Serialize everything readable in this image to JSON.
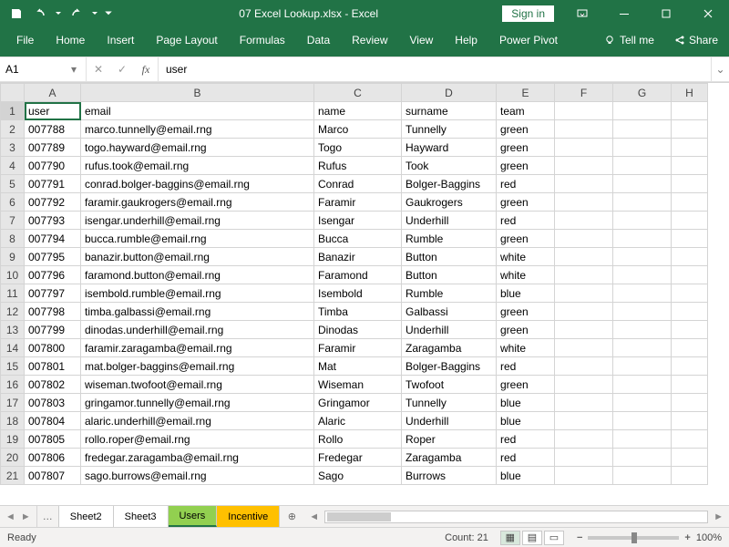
{
  "title": "07 Excel Lookup.xlsx - Excel",
  "signin": "Sign in",
  "ribbon": [
    "File",
    "Home",
    "Insert",
    "Page Layout",
    "Formulas",
    "Data",
    "Review",
    "View",
    "Help",
    "Power Pivot"
  ],
  "tellme": "Tell me",
  "share": "Share",
  "namebox": "A1",
  "formula": "user",
  "columns": [
    "A",
    "B",
    "C",
    "D",
    "E",
    "F",
    "G",
    "H"
  ],
  "headerRow": [
    "user",
    "email",
    "name",
    "surname",
    "team",
    "",
    "",
    ""
  ],
  "rows": [
    [
      "007788",
      "marco.tunnelly@email.rng",
      "Marco",
      "Tunnelly",
      "green",
      "",
      "",
      ""
    ],
    [
      "007789",
      "togo.hayward@email.rng",
      "Togo",
      "Hayward",
      "green",
      "",
      "",
      ""
    ],
    [
      "007790",
      "rufus.took@email.rng",
      "Rufus",
      "Took",
      "green",
      "",
      "",
      ""
    ],
    [
      "007791",
      "conrad.bolger-baggins@email.rng",
      "Conrad",
      "Bolger-Baggins",
      "red",
      "",
      "",
      ""
    ],
    [
      "007792",
      "faramir.gaukrogers@email.rng",
      "Faramir",
      "Gaukrogers",
      "green",
      "",
      "",
      ""
    ],
    [
      "007793",
      "isengar.underhill@email.rng",
      "Isengar",
      "Underhill",
      "red",
      "",
      "",
      ""
    ],
    [
      "007794",
      "bucca.rumble@email.rng",
      "Bucca",
      "Rumble",
      "green",
      "",
      "",
      ""
    ],
    [
      "007795",
      "banazir.button@email.rng",
      "Banazir",
      "Button",
      "white",
      "",
      "",
      ""
    ],
    [
      "007796",
      "faramond.button@email.rng",
      "Faramond",
      "Button",
      "white",
      "",
      "",
      ""
    ],
    [
      "007797",
      "isembold.rumble@email.rng",
      "Isembold",
      "Rumble",
      "blue",
      "",
      "",
      ""
    ],
    [
      "007798",
      "timba.galbassi@email.rng",
      "Timba",
      "Galbassi",
      "green",
      "",
      "",
      ""
    ],
    [
      "007799",
      "dinodas.underhill@email.rng",
      "Dinodas",
      "Underhill",
      "green",
      "",
      "",
      ""
    ],
    [
      "007800",
      "faramir.zaragamba@email.rng",
      "Faramir",
      "Zaragamba",
      "white",
      "",
      "",
      ""
    ],
    [
      "007801",
      "mat.bolger-baggins@email.rng",
      "Mat",
      "Bolger-Baggins",
      "red",
      "",
      "",
      ""
    ],
    [
      "007802",
      "wiseman.twofoot@email.rng",
      "Wiseman",
      "Twofoot",
      "green",
      "",
      "",
      ""
    ],
    [
      "007803",
      "gringamor.tunnelly@email.rng",
      "Gringamor",
      "Tunnelly",
      "blue",
      "",
      "",
      ""
    ],
    [
      "007804",
      "alaric.underhill@email.rng",
      "Alaric",
      "Underhill",
      "blue",
      "",
      "",
      ""
    ],
    [
      "007805",
      "rollo.roper@email.rng",
      "Rollo",
      "Roper",
      "red",
      "",
      "",
      ""
    ],
    [
      "007806",
      "fredegar.zaragamba@email.rng",
      "Fredegar",
      "Zaragamba",
      "red",
      "",
      "",
      ""
    ],
    [
      "007807",
      "sago.burrows@email.rng",
      "Sago",
      "Burrows",
      "blue",
      "",
      "",
      ""
    ]
  ],
  "sheets": {
    "prev": "Sheet2",
    "prev2": "Sheet3",
    "active": "Users",
    "next": "Incentive"
  },
  "status": {
    "ready": "Ready",
    "countLabel": "Count:",
    "count": "21",
    "zoom": "100%"
  }
}
